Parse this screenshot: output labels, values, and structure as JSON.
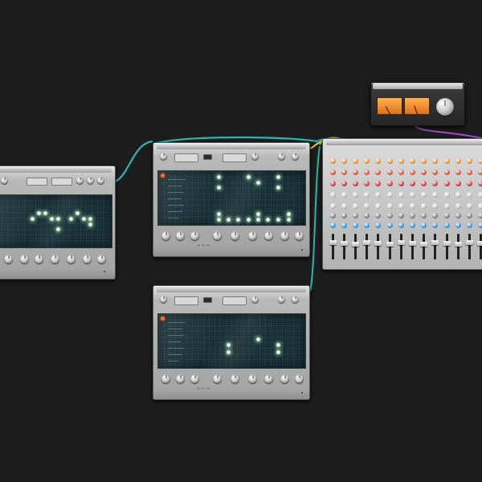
{
  "workspace": {
    "background": "#1d1d1d"
  },
  "devices": {
    "sequencer_left": {
      "name": "",
      "lcd_a": "",
      "lcd_b": ""
    },
    "sequencer_top": {
      "name": "",
      "lcd_a": "",
      "lcd_b": ""
    },
    "sequencer_bottom": {
      "name": "",
      "lcd_a": "",
      "lcd_b": ""
    },
    "mixer": {
      "channel_count": 14,
      "knob_row_colors": [
        "#f0a040",
        "#e06040",
        "#d84040",
        "#cfcfcf",
        "#d0d0d0",
        "#8a8a8a",
        "#3aa0e8"
      ]
    },
    "vu_meter": {
      "meter_color": "#f08a2a"
    }
  },
  "cables": {
    "colors": {
      "teal": "#2ab8b0",
      "yellow": "#e2d23a",
      "purple": "#a04ec8"
    }
  },
  "icons": {
    "knob": "knob-icon",
    "led": "led-step-icon",
    "record": "record-dot-icon",
    "fader": "fader-icon"
  }
}
